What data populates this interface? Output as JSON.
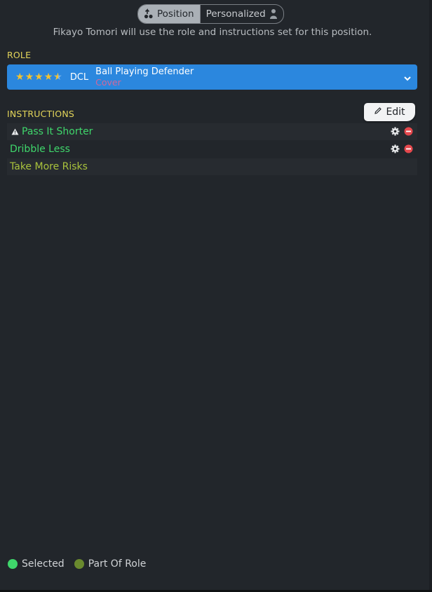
{
  "header": {
    "toggle": {
      "position_label": "Position",
      "personalized_label": "Personalized",
      "active": "position"
    },
    "info_text": "Fikayo Tomori will use the role and instructions set for this position."
  },
  "role": {
    "section_title": "ROLE",
    "rating_stars": 4.5,
    "position": "DCL",
    "name": "Ball Playing Defender",
    "duty": "Cover"
  },
  "instructions": {
    "section_title": "INSTRUCTIONS",
    "edit_label": "Edit",
    "items": [
      {
        "label": "Pass It Shorter",
        "state": "selected",
        "warning": true,
        "editable": true
      },
      {
        "label": "Dribble Less",
        "state": "selected",
        "warning": false,
        "editable": true
      },
      {
        "label": "Take More Risks",
        "state": "part_of_role",
        "warning": false,
        "editable": false
      }
    ]
  },
  "legend": {
    "selected_label": "Selected",
    "part_of_role_label": "Part Of Role"
  },
  "colors": {
    "selected": "#3fd66b",
    "part_of_role": "#a9c23c",
    "role_bar": "#2b87de",
    "section_title": "#e3d55a",
    "duty": "#d2689a",
    "remove": "#e5484d"
  }
}
